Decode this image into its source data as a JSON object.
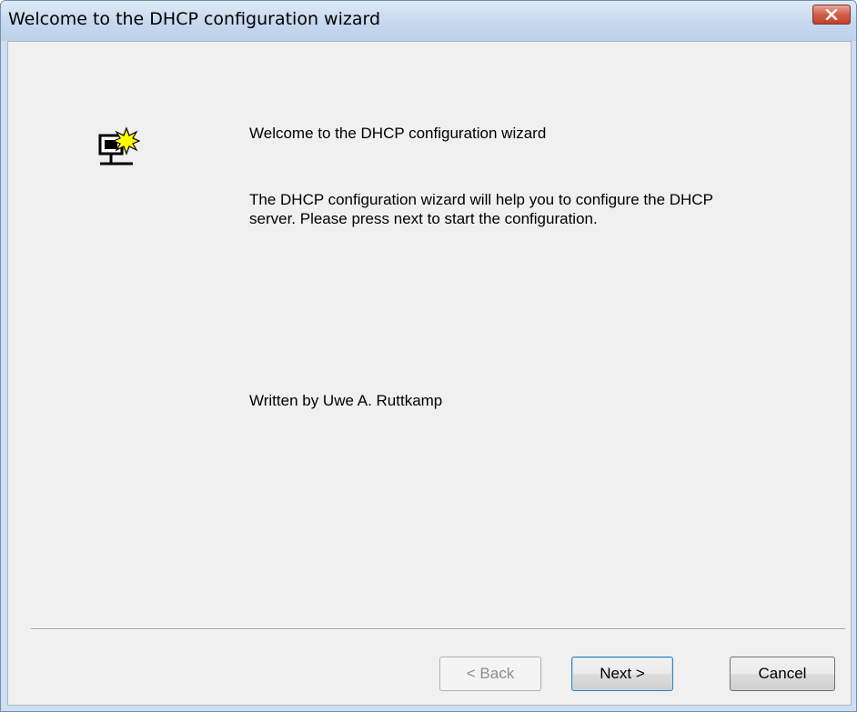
{
  "window": {
    "title": "Welcome to the DHCP configuration wizard"
  },
  "icons": {
    "app": "network-computer-starburst-icon",
    "close": "close-icon"
  },
  "content": {
    "heading": "Welcome to the DHCP configuration wizard",
    "description": "The DHCP configuration wizard will help you to configure the DHCP server. Please press next to start the configuration.",
    "author": "Written by Uwe A. Ruttkamp"
  },
  "buttons": {
    "back": "< Back",
    "next": "Next >",
    "cancel": "Cancel"
  },
  "colors": {
    "close_button": "#c9472f",
    "icon_star": "#ffff00"
  }
}
